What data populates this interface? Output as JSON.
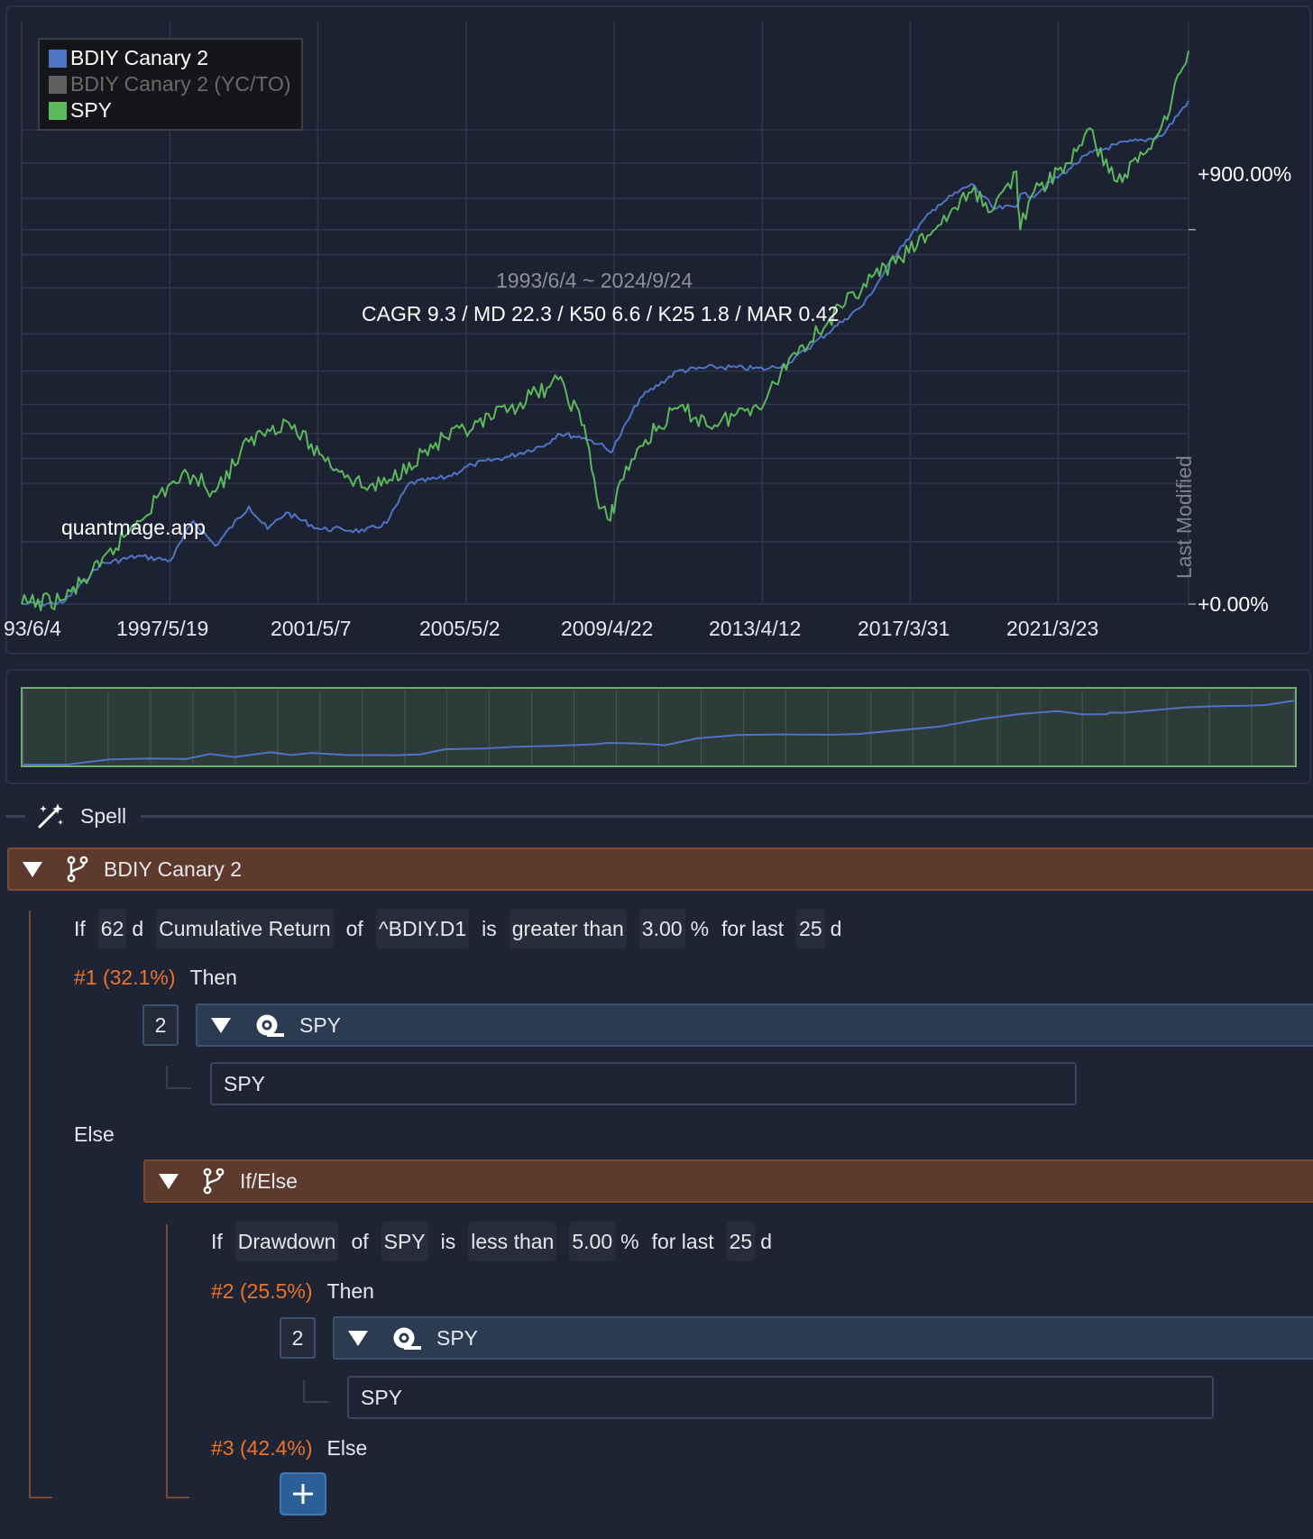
{
  "chart_data": {
    "type": "line",
    "x_tick_labels": [
      "93/6/4",
      "1997/5/19",
      "2001/5/7",
      "2005/5/2",
      "2009/4/22",
      "2013/4/12",
      "2017/3/31",
      "2021/3/23"
    ],
    "y_tick_labels": [
      "+900.00%",
      "+0.00%"
    ],
    "vertical_axis_label": "Last Modified",
    "date_range_label": "1993/6/4 ~ 2024/9/24",
    "stats_label": "CAGR 9.3 / MD 22.3 / K50 6.6 / K25 1.8 / MAR 0.42",
    "watermark": "quantmage.app",
    "legend": [
      {
        "name": "BDIY Canary 2",
        "color": "#4f74c4"
      },
      {
        "name": "BDIY Canary 2 (YC/TO)",
        "color": "#606060"
      },
      {
        "name": "SPY",
        "color": "#5cb85c"
      }
    ],
    "x": [
      1993.4,
      1994.5,
      1995.5,
      1996.5,
      1997.4,
      1998.0,
      1998.6,
      1999.5,
      2000.0,
      2000.5,
      2001.4,
      2002.0,
      2002.6,
      2003.2,
      2003.8,
      2004.8,
      2005.5,
      2006.5,
      2007.5,
      2007.8,
      2008.5,
      2008.9,
      2009.2,
      2009.4,
      2010.0,
      2011.0,
      2012.0,
      2013.4,
      2014.0,
      2015.5,
      2016.0,
      2017.0,
      2018.0,
      2018.9,
      2019.5,
      2020.1,
      2020.2,
      2020.5,
      2021.5,
      2022.0,
      2022.8,
      2023.5,
      2024.0,
      2024.72
    ],
    "series": [
      {
        "name": "BDIY Canary 2",
        "color": "#4f74c4",
        "values": [
          0,
          2,
          95,
          115,
          105,
          200,
          140,
          235,
          180,
          220,
          180,
          180,
          175,
          195,
          290,
          305,
          335,
          355,
          385,
          410,
          400,
          385,
          365,
          395,
          495,
          560,
          570,
          565,
          580,
          685,
          720,
          860,
          960,
          1010,
          950,
          955,
          985,
          980,
          1045,
          1080,
          1105,
          1115,
          1125,
          1210
        ]
      },
      {
        "name": "SPY",
        "color": "#5cb85c",
        "values": [
          0,
          10,
          90,
          200,
          290,
          310,
          270,
          390,
          420,
          440,
          360,
          320,
          280,
          290,
          340,
          400,
          420,
          470,
          520,
          540,
          430,
          230,
          200,
          280,
          380,
          470,
          430,
          495,
          590,
          720,
          770,
          830,
          910,
          990,
          950,
          1040,
          900,
          980,
          1060,
          1140,
          1015,
          1080,
          1150,
          1330
        ]
      }
    ],
    "ylim": [
      0,
      1400
    ],
    "grid": true,
    "legend_position": "top-left",
    "navigator": {
      "type": "line",
      "series": "BDIY Canary 2"
    }
  },
  "spell": {
    "label": "Spell",
    "icon": "magic-wand-icon"
  },
  "root": {
    "name": "BDIY Canary 2",
    "icon": "branch-icon",
    "condition": {
      "if": "If",
      "window": "62",
      "unit": "d",
      "indicator": "Cumulative Return",
      "of": "of",
      "asset": "^BDIY.D1",
      "is": "is",
      "comparator": "greater than",
      "value": "3.00",
      "pct": "%",
      "for_last": "for last",
      "days": "25",
      "days_unit": "d"
    },
    "then_label": {
      "id": "#1 (32.1%)",
      "text": "Then"
    },
    "then_node": {
      "weight": "2",
      "name": "SPY",
      "icon": "ticker-group-icon",
      "ticker": "SPY"
    },
    "else_label": "Else",
    "else_node": {
      "name": "If/Else",
      "icon": "branch-icon",
      "condition": {
        "if": "If",
        "indicator": "Drawdown",
        "of": "of",
        "asset": "SPY",
        "is": "is",
        "comparator": "less than",
        "value": "5.00",
        "pct": "%",
        "for_last": "for last",
        "days": "25",
        "days_unit": "d"
      },
      "then_label": {
        "id": "#2 (25.5%)",
        "text": "Then"
      },
      "then_node": {
        "weight": "2",
        "name": "SPY",
        "icon": "ticker-group-icon",
        "ticker": "SPY"
      },
      "else_label": {
        "id": "#3 (42.4%)",
        "text": "Else"
      },
      "add_button": "plus-icon"
    }
  }
}
